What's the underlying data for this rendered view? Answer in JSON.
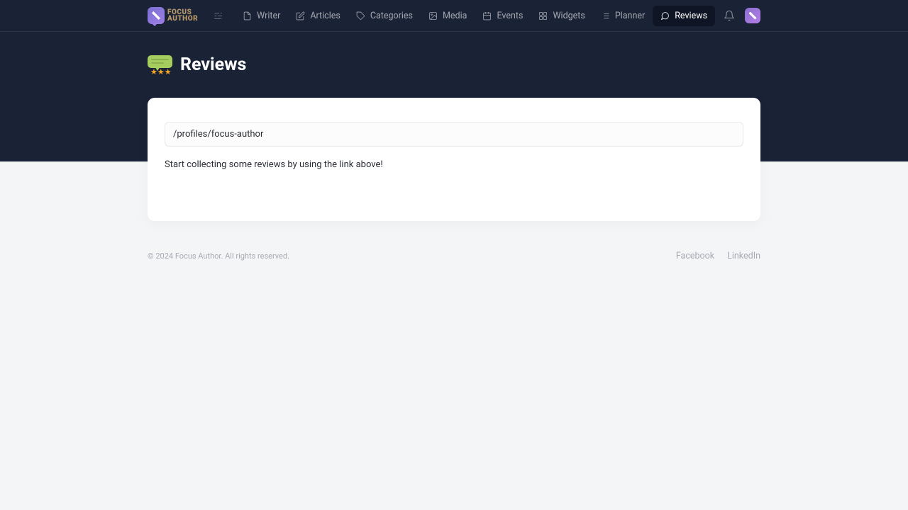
{
  "brand": {
    "line1": "FOCUS",
    "line2": "AUTHOR"
  },
  "nav": {
    "items": [
      {
        "label": "Writer"
      },
      {
        "label": "Articles"
      },
      {
        "label": "Categories"
      },
      {
        "label": "Media"
      },
      {
        "label": "Events"
      },
      {
        "label": "Widgets"
      },
      {
        "label": "Planner"
      },
      {
        "label": "Reviews"
      }
    ]
  },
  "page": {
    "title": "Reviews"
  },
  "main": {
    "profile_link": "/profiles/focus-author",
    "instruction": "Start collecting some reviews by using the link above!"
  },
  "footer": {
    "copyright": "© 2024 Focus Author. All rights reserved.",
    "link_facebook": "Facebook",
    "link_linkedin": "LinkedIn"
  }
}
